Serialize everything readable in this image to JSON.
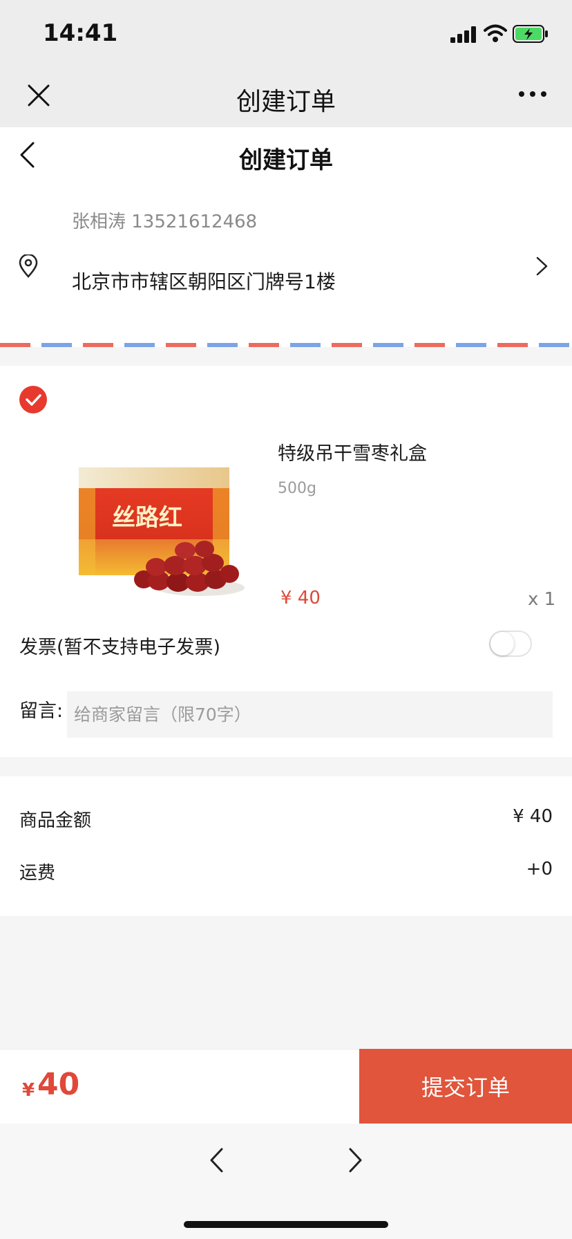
{
  "status_bar": {
    "time": "14:41"
  },
  "wechat_bar": {
    "title": "创建订单"
  },
  "page": {
    "title": "创建订单"
  },
  "address": {
    "name_phone": "张相涛 13521612468",
    "detail": "北京市市辖区朝阳区门牌号1楼"
  },
  "product": {
    "name": "特级吊干雪枣礼盒",
    "spec": "500g",
    "price": "¥ 40",
    "quantity": "x 1",
    "image_label": "丝路红"
  },
  "invoice": {
    "label": "发票(暂不支持电子发票)",
    "enabled": false
  },
  "message": {
    "label": "留言:",
    "placeholder": "给商家留言（限70字）"
  },
  "summary": {
    "goods_label": "商品金额",
    "goods_value": "¥ 40",
    "shipping_label": "运费",
    "shipping_value": "+0"
  },
  "footer": {
    "currency": "¥",
    "total": "40",
    "submit_label": "提交订单"
  },
  "colors": {
    "accent": "#e0483a",
    "submit_bg": "#e0553b",
    "check": "#e8392e"
  }
}
